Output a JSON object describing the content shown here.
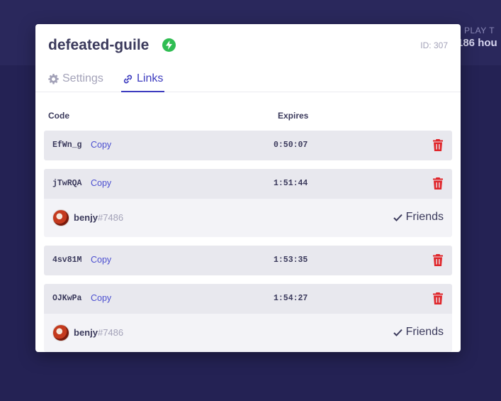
{
  "background": {
    "stat_label": "PLAY T",
    "stat_value": "186 hou"
  },
  "modal": {
    "server_name": "defeated-guile",
    "status_icon": "lightning-bolt-icon",
    "server_id": "ID: 307",
    "tabs": [
      {
        "label": "Settings",
        "icon": "gear-icon",
        "active": false
      },
      {
        "label": "Links",
        "icon": "link-icon",
        "active": true
      }
    ],
    "columns": {
      "code": "Code",
      "expires": "Expires"
    },
    "copy_label": "Copy",
    "links": [
      {
        "code": "EfWn_g",
        "expires": "0:50:07",
        "user": null
      },
      {
        "code": "jTwRQA",
        "expires": "1:51:44",
        "user": {
          "name": "benjy",
          "discriminator": "#7486",
          "status": "Friends"
        }
      },
      {
        "code": "4sv81M",
        "expires": "1:53:35",
        "user": null
      },
      {
        "code": "OJKwPa",
        "expires": "1:54:27",
        "user": {
          "name": "benjy",
          "discriminator": "#7486",
          "status": "Friends"
        }
      }
    ]
  },
  "colors": {
    "page_bg": "#242254",
    "accent": "#3d3cbf",
    "delete": "#e0262b",
    "online": "#2fbd52"
  }
}
